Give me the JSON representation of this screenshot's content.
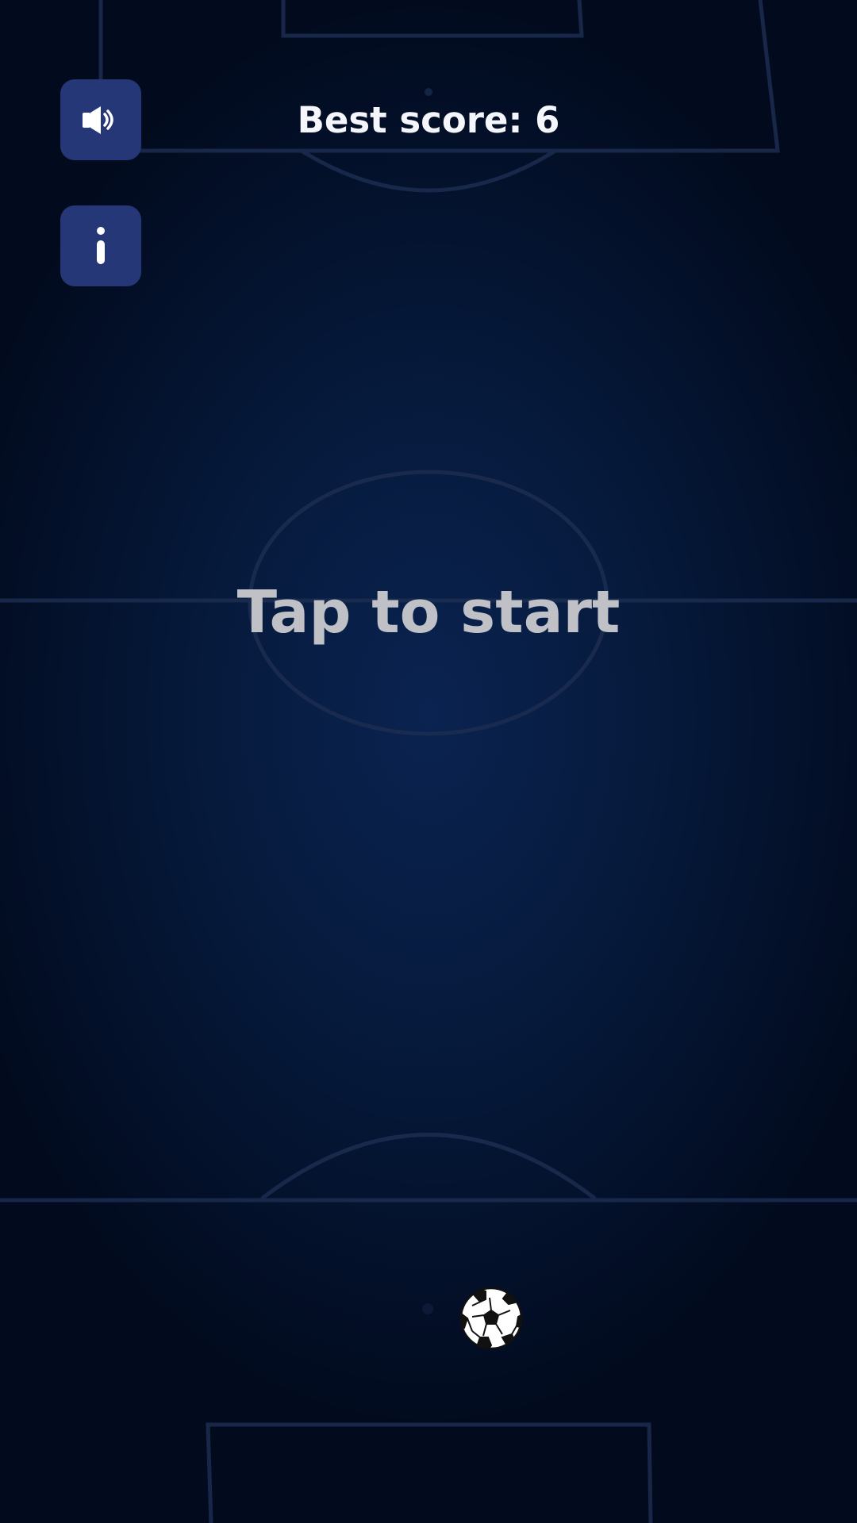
{
  "hud": {
    "best_score_text": "Best score: 6"
  },
  "prompt": {
    "start_text": "Tap to start"
  },
  "buttons": {
    "sound_icon": "speaker-icon",
    "info_icon": "info-icon"
  },
  "ball": {
    "icon": "soccer-ball-icon"
  },
  "colors": {
    "background": "#061a3c",
    "button_fill": "#253777",
    "pitch_lines": "#1c2d50",
    "score_text": "#f4f6fb",
    "start_text": "#bfc1c6"
  }
}
